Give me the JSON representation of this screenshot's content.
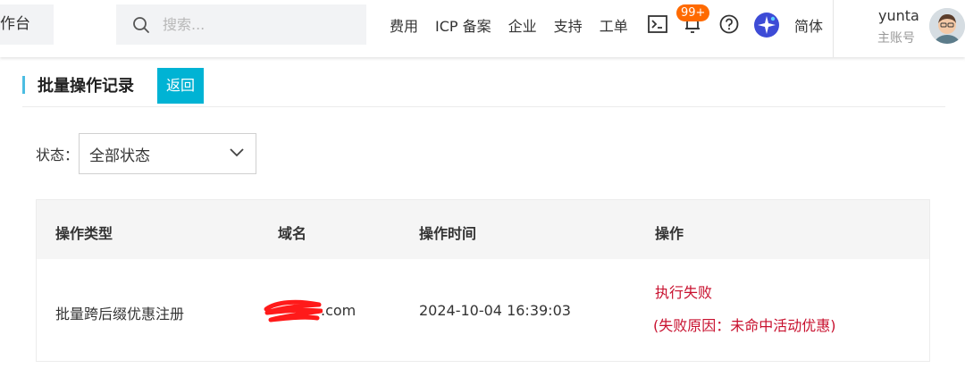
{
  "topbar": {
    "workbench_label": "工作台",
    "search_placeholder": "搜索...",
    "nav": [
      "费用",
      "ICP 备案",
      "企业",
      "支持",
      "工单"
    ],
    "notification_badge": "99+",
    "language": "简体",
    "user": {
      "name": "yunta",
      "account_type": "主账号"
    }
  },
  "page": {
    "title": "批量操作记录",
    "back_label": "返回"
  },
  "filter": {
    "label": "状态：",
    "selected": "全部状态"
  },
  "table": {
    "columns": [
      "操作类型",
      "域名",
      "操作时间",
      "操作"
    ],
    "rows": [
      {
        "type": "批量跨后缀优惠注册",
        "domain_suffix": ".com",
        "time": "2024-10-04 16:39:03",
        "status": "执行失败",
        "reason": "(失败原因：未命中活动优惠)"
      }
    ]
  },
  "colors": {
    "accent": "#00b3d4",
    "badge": "#ff6a00",
    "error": "#c8102e",
    "redaction": "#ff1a1a"
  }
}
